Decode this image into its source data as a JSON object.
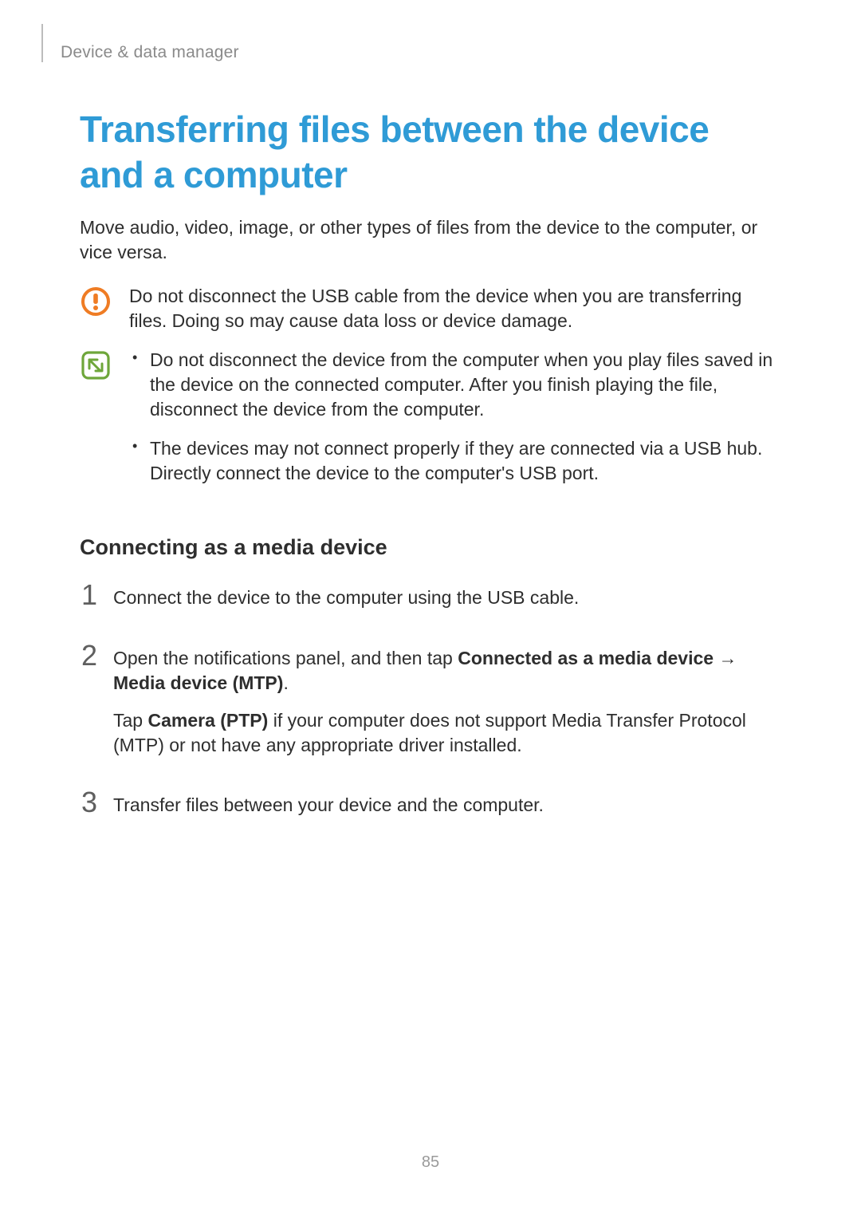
{
  "breadcrumb": "Device & data manager",
  "title": "Transferring files between the device and a computer",
  "intro": "Move audio, video, image, or other types of files from the device to the computer, or vice versa.",
  "caution": "Do not disconnect the USB cable from the device when you are transferring files. Doing so may cause data loss or device damage.",
  "notes": [
    "Do not disconnect the device from the computer when you play files saved in the device on the connected computer. After you finish playing the file, disconnect the device from the computer.",
    "The devices may not connect properly if they are connected via a USB hub. Directly connect the device to the computer's USB port."
  ],
  "subhead": "Connecting as a media device",
  "steps": {
    "s1": {
      "num": "1",
      "text": "Connect the device to the computer using the USB cable."
    },
    "s2": {
      "num": "2",
      "pre": "Open the notifications panel, and then tap ",
      "b1": "Connected as a media device",
      "arrow": " → ",
      "b2": "Media device (MTP)",
      "post": ".",
      "extra_pre": "Tap ",
      "extra_b": "Camera (PTP)",
      "extra_post": " if your computer does not support Media Transfer Protocol (MTP) or not have any appropriate driver installed."
    },
    "s3": {
      "num": "3",
      "text": "Transfer files between your device and the computer."
    }
  },
  "pageNumber": "85"
}
